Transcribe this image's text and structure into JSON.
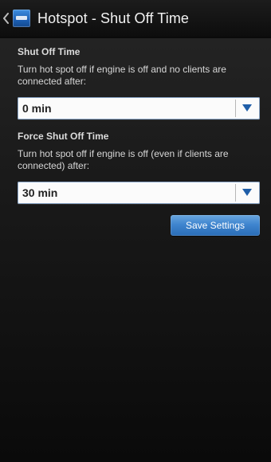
{
  "actionbar": {
    "title": "Hotspot - Shut Off Time",
    "back_icon": "chevron-left-icon",
    "app_icon": "hotspot-app-icon"
  },
  "shut_off": {
    "section_title": "Shut Off Time",
    "description": "Turn hot spot off if engine is off and no clients are connected after:",
    "select_value": "0 min",
    "dropdown_icon": "triangle-down-icon"
  },
  "force_shut_off": {
    "section_title": "Force Shut Off Time",
    "description": "Turn hot spot off if engine is off (even if clients are connected) after:",
    "select_value": "30 min",
    "dropdown_icon": "triangle-down-icon"
  },
  "actions": {
    "save_label": "Save Settings"
  },
  "colors": {
    "accent": "#2a6db7",
    "background": "#1b1b1b",
    "text_light": "#d7d7d7"
  }
}
